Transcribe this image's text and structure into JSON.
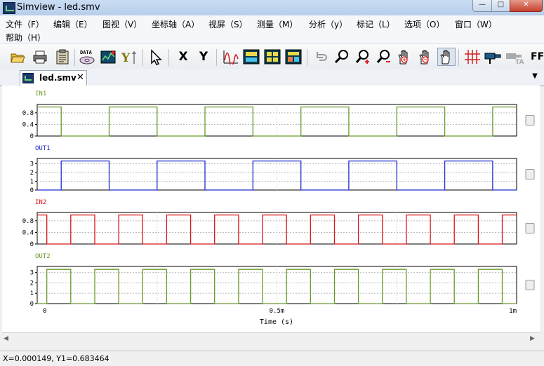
{
  "window": {
    "title": "Simview - led.smv"
  },
  "menu": [
    "文件（F）",
    "编辑（E）",
    "图视（V）",
    "坐标轴（A）",
    "视屏（S）",
    "测量（M）",
    "分析（y）",
    "标记（L）",
    "选项（O）",
    "窗口（W）",
    "帮助（H）"
  ],
  "toolbar": {
    "x_label": "X",
    "y_label": "Y",
    "data_label": "DATA",
    "ff_label": "FF"
  },
  "tab": {
    "label": "led.smv",
    "close": "✕"
  },
  "xaxis": {
    "label": "Time (s)",
    "ticks": [
      "0",
      "0.5m",
      "1m"
    ]
  },
  "plots": [
    {
      "name": "IN1",
      "color": "#6b9a2a",
      "ticks": [
        "0.8",
        "0.4",
        "0"
      ]
    },
    {
      "name": "OUT1",
      "color": "#1c2fd1",
      "ticks": [
        "3",
        "2",
        "1",
        "0"
      ]
    },
    {
      "name": "IN2",
      "color": "#dc1414",
      "ticks": [
        "0.8",
        "0.4",
        "0"
      ]
    },
    {
      "name": "OUT2",
      "color": "#6b9a2a",
      "ticks": [
        "3",
        "2",
        "1",
        "0"
      ]
    }
  ],
  "chart_data": {
    "type": "line",
    "x_unit": "s",
    "xlim": [
      0,
      0.001
    ],
    "series": [
      {
        "name": "IN1",
        "ylim": [
          0,
          1
        ],
        "low": 0,
        "high": 1,
        "period": 0.0002,
        "duty": 0.5,
        "delay": 5e-05,
        "invert": true
      },
      {
        "name": "OUT1",
        "ylim": [
          0,
          3.3
        ],
        "low": 0,
        "high": 3.3,
        "period": 0.0002,
        "duty": 0.5,
        "delay": 5e-05,
        "invert": false
      },
      {
        "name": "IN2",
        "ylim": [
          0,
          1
        ],
        "low": 0,
        "high": 1,
        "period": 0.0001,
        "duty": 0.5,
        "delay": 2e-05,
        "invert": true
      },
      {
        "name": "OUT2",
        "ylim": [
          0,
          3.3
        ],
        "low": 0,
        "high": 3.3,
        "period": 0.0001,
        "duty": 0.5,
        "delay": 2e-05,
        "invert": false
      }
    ]
  },
  "status": {
    "text": "X=0.000149, Y1=0.683464"
  }
}
